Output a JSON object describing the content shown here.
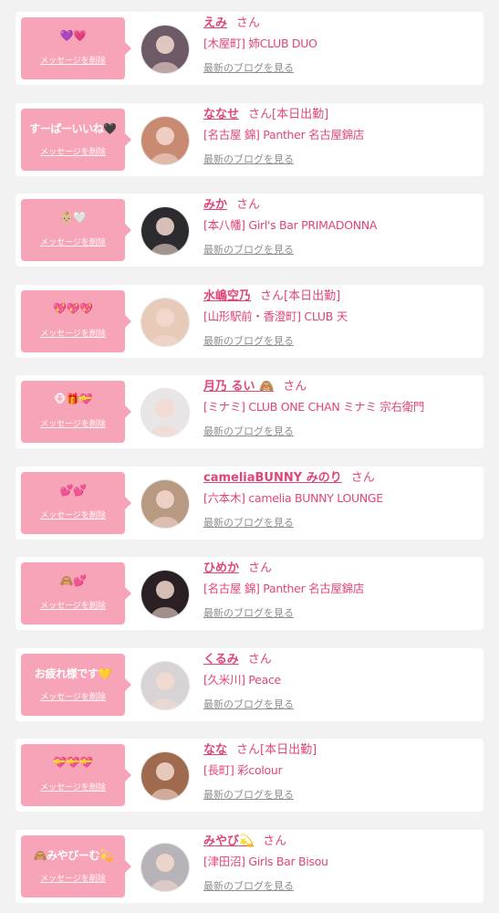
{
  "common": {
    "san": "さん",
    "delete_label": "メッセージを削除",
    "blog_label": "最新のブログを見る"
  },
  "colors": {
    "bubble": "#f8a4b8",
    "accent": "#e0457a",
    "link_gray": "#8e8e8e"
  },
  "cards": [
    {
      "message": "💜💗",
      "name": "えみ",
      "badge": "",
      "shop": "[木屋町] 姉CLUB DUO",
      "avatar_icon": "avatar-photo-icon",
      "avatar_bg": "#6d5a66"
    },
    {
      "message": "すーぱーいいね🖤",
      "name": "ななせ",
      "badge": "[本日出勤]",
      "shop": "[名古屋 錦] Panther 名古屋錦店",
      "avatar_icon": "avatar-photo-icon",
      "avatar_bg": "#c98a72"
    },
    {
      "message": "👶🏼🤍",
      "name": "みか",
      "badge": "",
      "shop": "[本八幡] Girl's Bar PRIMADONNA",
      "avatar_icon": "avatar-photo-icon",
      "avatar_bg": "#2c2c30"
    },
    {
      "message": "💖💖💖",
      "name": "水嶋空乃",
      "badge": "[本日出勤]",
      "shop": "[山形駅前・香澄町] CLUB 天",
      "avatar_icon": "avatar-photo-icon",
      "avatar_bg": "#e7cbb8"
    },
    {
      "message": "🐵🎁💝",
      "name": "月乃 るい 🙈",
      "badge": "",
      "shop": "[ミナミ] CLUB ONE CHAN ミナミ 宗右衛門",
      "avatar_icon": "avatar-photo-icon",
      "avatar_bg": "#e9e4e6"
    },
    {
      "message": "💕💕",
      "name": "cameliaBUNNY みのり",
      "badge": "",
      "shop": "[六本木] camelia BUNNY LOUNGE",
      "avatar_icon": "avatar-photo-icon",
      "avatar_bg": "#b89a82"
    },
    {
      "message": "🙈💕",
      "name": "ひめか",
      "badge": "",
      "shop": "[名古屋 錦] Panther 名古屋錦店",
      "avatar_icon": "avatar-photo-icon",
      "avatar_bg": "#2a2024"
    },
    {
      "message": "お疲れ様です💛",
      "name": "くるみ",
      "badge": "",
      "shop": "[久米川] Peace",
      "avatar_icon": "avatar-photo-icon",
      "avatar_bg": "#d8d4d6"
    },
    {
      "message": "💝💝💝",
      "name": "なな",
      "badge": "[本日出勤]",
      "shop": "[長町] 彩colour",
      "avatar_icon": "avatar-photo-icon",
      "avatar_bg": "#a06a4e"
    },
    {
      "message": "🙈みやびーむ💫",
      "name": "みやび💫",
      "badge": "",
      "shop": "[津田沼] Girls Bar Bisou",
      "avatar_icon": "avatar-photo-icon",
      "avatar_bg": "#b8b3b8"
    }
  ]
}
